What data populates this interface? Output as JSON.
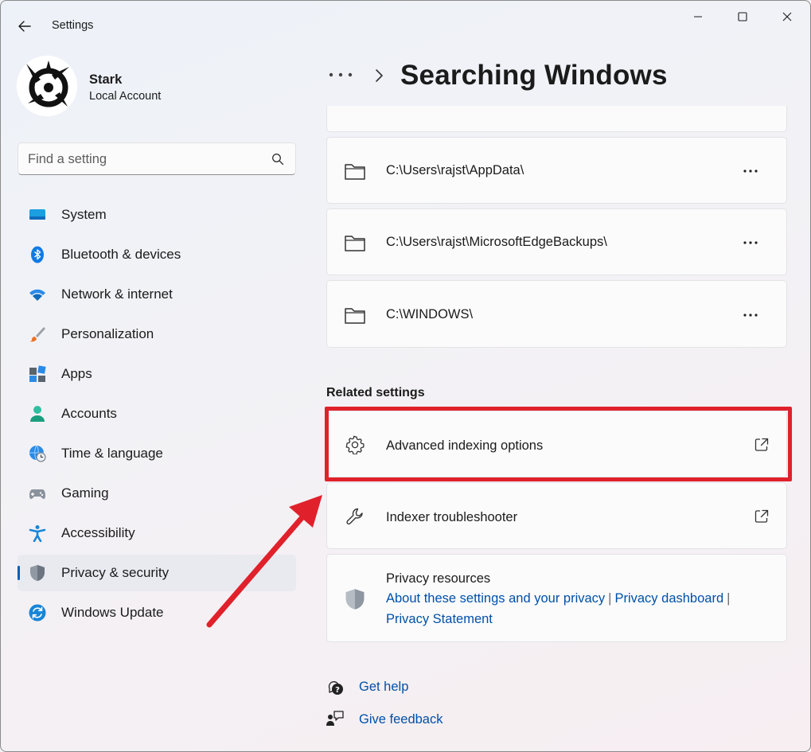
{
  "window": {
    "app_title": "Settings"
  },
  "profile": {
    "name": "Stark",
    "account_type": "Local Account"
  },
  "search": {
    "placeholder": "Find a setting",
    "value": ""
  },
  "sidebar": {
    "items": [
      {
        "label": "System",
        "icon": "system-icon"
      },
      {
        "label": "Bluetooth & devices",
        "icon": "bluetooth-icon"
      },
      {
        "label": "Network & internet",
        "icon": "wifi-icon"
      },
      {
        "label": "Personalization",
        "icon": "brush-icon"
      },
      {
        "label": "Apps",
        "icon": "apps-icon"
      },
      {
        "label": "Accounts",
        "icon": "accounts-icon"
      },
      {
        "label": "Time & language",
        "icon": "globe-clock-icon"
      },
      {
        "label": "Gaming",
        "icon": "gamepad-icon"
      },
      {
        "label": "Accessibility",
        "icon": "accessibility-icon"
      },
      {
        "label": "Privacy & security",
        "icon": "shield-icon",
        "active": true
      },
      {
        "label": "Windows Update",
        "icon": "update-icon"
      }
    ]
  },
  "header": {
    "title": "Searching Windows"
  },
  "excluded_folders": [
    {
      "path": "C:\\Users\\rajst\\AppData\\"
    },
    {
      "path": "C:\\Users\\rajst\\MicrosoftEdgeBackups\\"
    },
    {
      "path": "C:\\WINDOWS\\"
    }
  ],
  "related_settings": {
    "title": "Related settings",
    "items": [
      {
        "label": "Advanced indexing options",
        "icon": "gear-icon"
      },
      {
        "label": "Indexer troubleshooter",
        "icon": "wrench-icon"
      }
    ]
  },
  "privacy_resources": {
    "title": "Privacy resources",
    "links": [
      "About these settings and your privacy",
      "Privacy dashboard",
      "Privacy Statement"
    ],
    "separator": "|"
  },
  "footer": {
    "get_help": "Get help",
    "give_feedback": "Give feedback"
  },
  "colors": {
    "accent": "#005fb8",
    "link": "#0050a8",
    "annotation": "#e0212b"
  }
}
